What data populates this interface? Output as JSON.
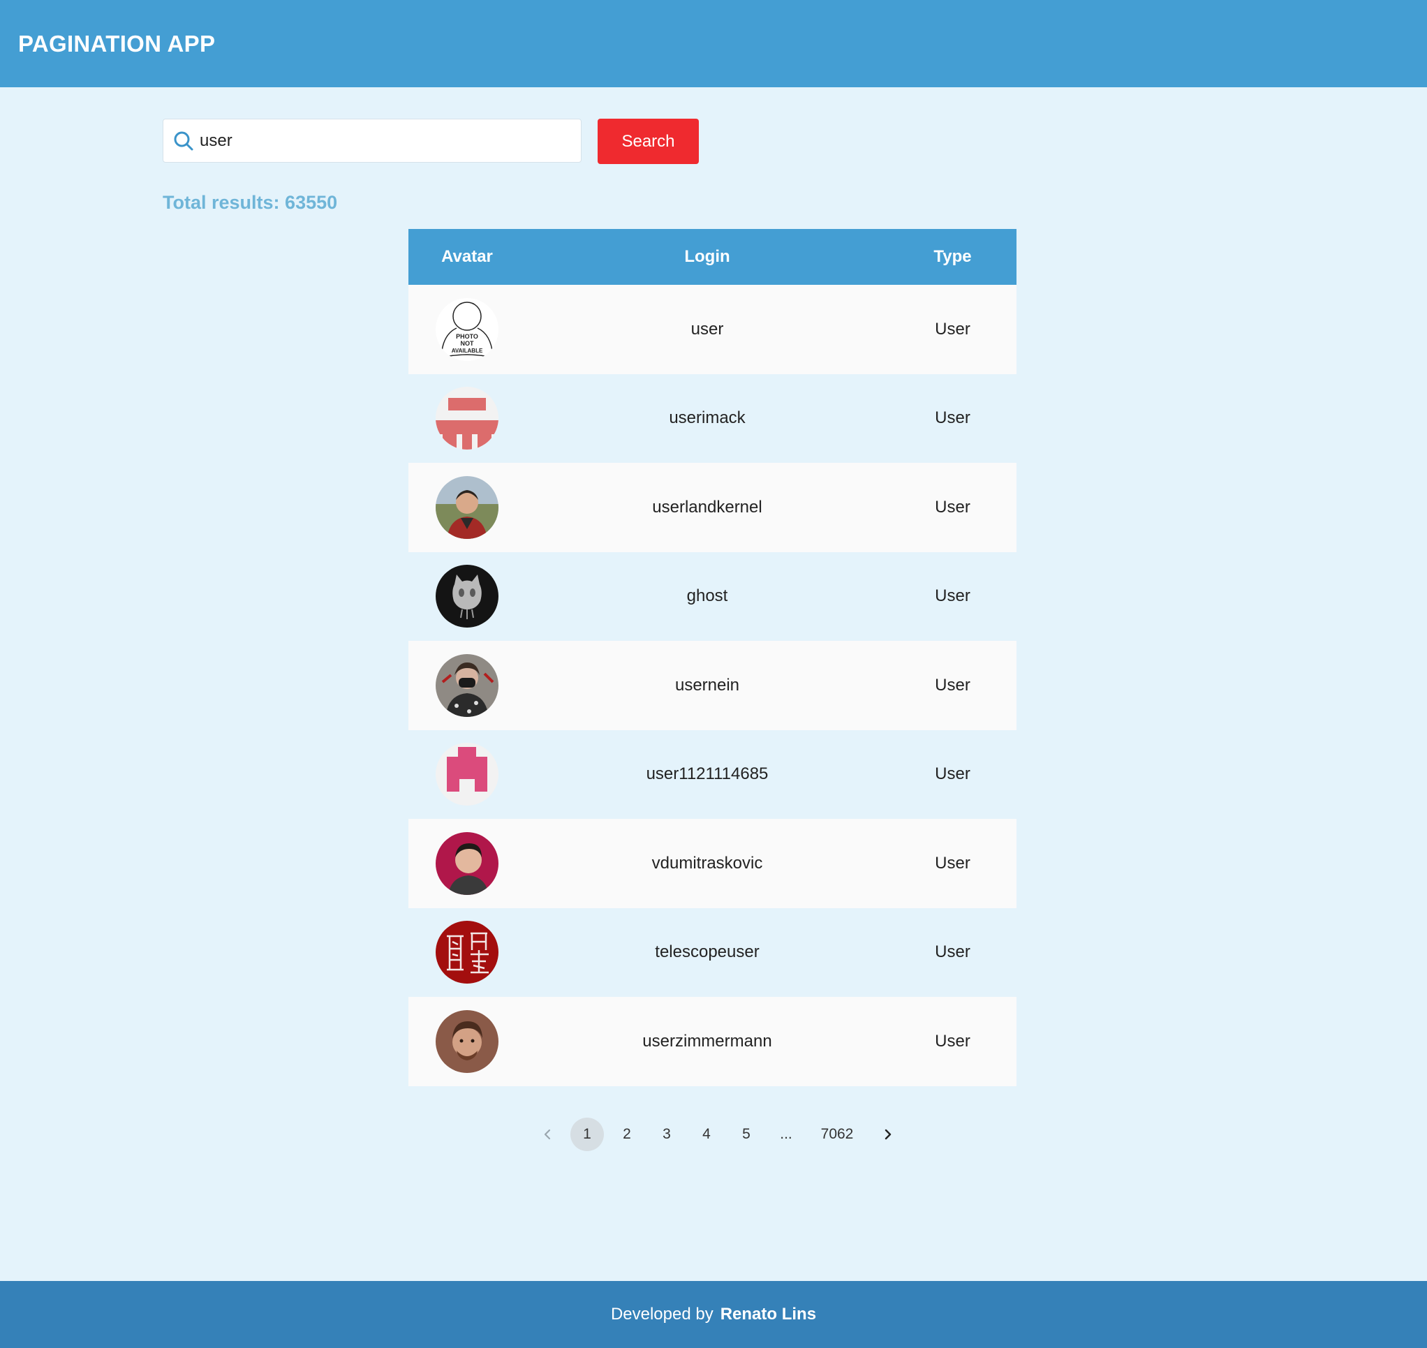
{
  "header": {
    "title": "PAGINATION APP"
  },
  "search": {
    "value": "user",
    "button_label": "Search"
  },
  "results": {
    "label": "Total results:",
    "count": "63550"
  },
  "table": {
    "columns": [
      "Avatar",
      "Login",
      "Type"
    ],
    "rows": [
      {
        "login": "user",
        "type": "User",
        "avatar": "photo-not-available"
      },
      {
        "login": "userimack",
        "type": "User",
        "avatar": "identicon-red"
      },
      {
        "login": "userlandkernel",
        "type": "User",
        "avatar": "photo-man-outdoors"
      },
      {
        "login": "ghost",
        "type": "User",
        "avatar": "ghost-octocat"
      },
      {
        "login": "usernein",
        "type": "User",
        "avatar": "photo-person-mask"
      },
      {
        "login": "user1121114685",
        "type": "User",
        "avatar": "identicon-pink"
      },
      {
        "login": "vdumitraskovic",
        "type": "User",
        "avatar": "photo-man-red-bg"
      },
      {
        "login": "telescopeuser",
        "type": "User",
        "avatar": "seal-red"
      },
      {
        "login": "userzimmermann",
        "type": "User",
        "avatar": "photo-man-brown"
      }
    ],
    "avatar_text": "PHOTO NOT AVAILABLE"
  },
  "pagination": {
    "pages": [
      "1",
      "2",
      "3",
      "4",
      "5",
      "...",
      "7062"
    ],
    "current": "1"
  },
  "footer": {
    "prefix": "Developed by",
    "author": "Renato Lins"
  },
  "colors": {
    "header_bg": "#449ed3",
    "page_bg": "#e4f3fb",
    "search_button": "#ef2a2f",
    "total_results": "#6fb5d8",
    "footer_bg": "#3581b8"
  }
}
